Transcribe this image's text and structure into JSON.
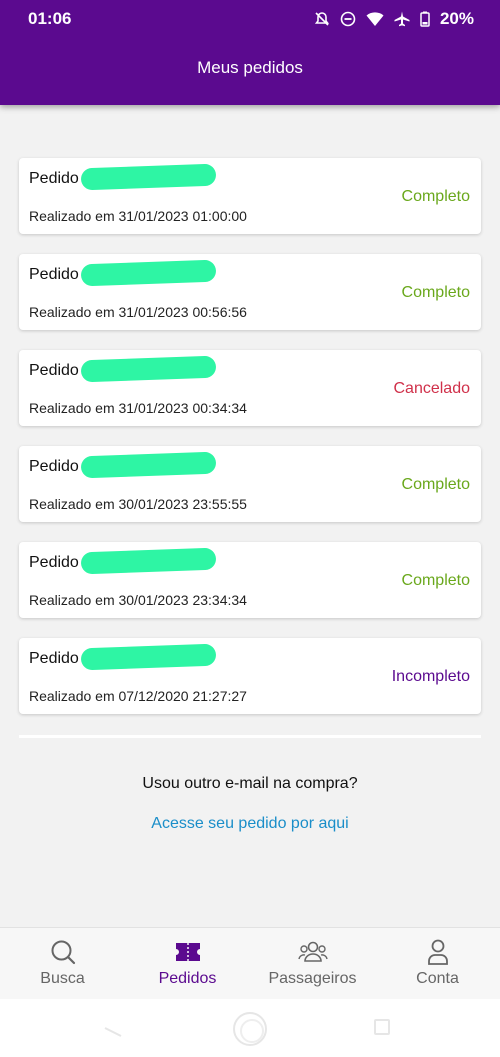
{
  "status_bar": {
    "time": "01:06",
    "battery": "20%"
  },
  "header": {
    "title": "Meus pedidos"
  },
  "orders": [
    {
      "name": "Pedido",
      "date": "Realizado em 31/01/2023 01:00:00",
      "status": "Completo",
      "status_color": "#6aa81c"
    },
    {
      "name": "Pedido",
      "date": "Realizado em 31/01/2023 00:56:56",
      "status": "Completo",
      "status_color": "#6aa81c"
    },
    {
      "name": "Pedido",
      "date": "Realizado em 31/01/2023 00:34:34",
      "status": "Cancelado",
      "status_color": "#d0304a"
    },
    {
      "name": "Pedido",
      "date": "Realizado em 30/01/2023 23:55:55",
      "status": "Completo",
      "status_color": "#6aa81c"
    },
    {
      "name": "Pedido",
      "date": "Realizado em 30/01/2023 23:34:34",
      "status": "Completo",
      "status_color": "#6aa81c"
    },
    {
      "name": "Pedido",
      "date": "Realizado em 07/12/2020 21:27:27",
      "status": "Incompleto",
      "status_color": "#5b0a8f"
    }
  ],
  "footer": {
    "other_email_text": "Usou outro e-mail na compra?",
    "access_link": "Acesse seu pedido por aqui"
  },
  "bottom_nav": [
    {
      "label": "Busca",
      "icon": "search-icon",
      "active": false
    },
    {
      "label": "Pedidos",
      "icon": "ticket-icon",
      "active": true
    },
    {
      "label": "Passageiros",
      "icon": "passengers-icon",
      "active": false
    },
    {
      "label": "Conta",
      "icon": "account-icon",
      "active": false
    }
  ],
  "colors": {
    "brand": "#5b0a8f",
    "completo": "#6aa81c",
    "cancelado": "#d0304a",
    "link": "#1a8ec9"
  }
}
